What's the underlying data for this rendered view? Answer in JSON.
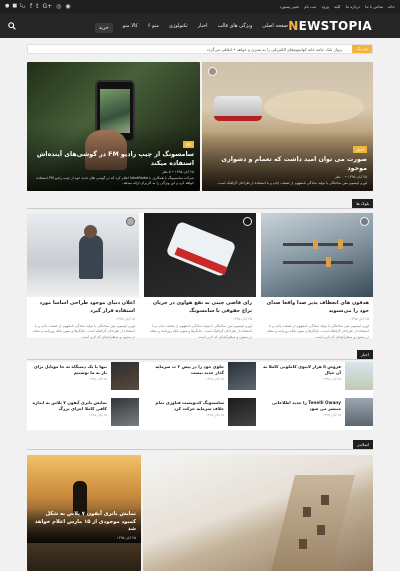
{
  "topbar": {
    "links": [
      "خانه",
      "تماس با ما",
      "درباره ما",
      "کلیه",
      "ورود",
      "ثبت نام",
      "تغییر پسورد"
    ],
    "user_label": "ربا"
  },
  "navbar": {
    "logo_first": "N",
    "logo_rest": "EWSTOPIA",
    "items": [
      "صفحه اصلی",
      "ویژگی های قالب",
      "اخبار",
      "تکنولوژی",
      "منو ۶",
      "کالا منو",
      "خرید"
    ]
  },
  "ticker": {
    "label": "تیتر یک",
    "text": "پرواز بانک جامه خانه کوانتیوم‌های الکتریکی را به سبزی و خواهد • اتفاقی می‌گردد"
  },
  "featured": [
    {
      "category": "کالا",
      "title": "سامسونگ از چیپ رادیو FM در گوشی‌های آینده‌اش استفاده میکند",
      "meta": "۲۵ آبان ۱۳۹۵ • ۵ نظر",
      "excerpt": "شرکت سامسونگ با همکاری با NextRadio اعلام کرد که در گوشی های جدید خود از چیپ رادیو FM استفاده خواهد کرد و این ویژگی را به کاربران ارائه میدهد."
    },
    {
      "category": "اخبار",
      "title": "صورت می توان امید داشت که تعمام و دشواری موجود",
      "meta": "۲۵ آبان ۱۳۹۵ • ۰ نظر",
      "excerpt": "لورم ایپسوم متن ساختگی با تولید سادگی نامفهوم از صنعت چاپ و با استفاده از طراحان گرافیک است."
    }
  ],
  "section_blocks": {
    "heading": "بلوک ها",
    "items": [
      {
        "title": "هدفون های انعطاف پذیر صدا واقعا صدای خود را می‌شنوید",
        "meta": "۲۵ آبان ۱۳۹۵",
        "excerpt": "لورم ایپسوم متن ساختگی با تولید سادگی نامفهوم از صنعت چاپ و با استفاده از طراحان گرافیک است. چاپگرها و متون بلکه روزنامه و مجله در ستون و سطرآنچنان که لازم است."
      },
      {
        "title": "رای قاضی چینی به نفع هواوی در جریان نزاع حقوقی با سامسونگ",
        "meta": "۲۵ آبان ۱۳۹۵",
        "excerpt": "لورم ایپسوم متن ساختگی با تولید سادگی نامفهوم از صنعت چاپ و با استفاده از طراحان گرافیک است. چاپگرها و متون بلکه روزنامه و مجله در ستون و سطرآنچنان که لازم است."
      },
      {
        "title": "اعلان دنیای موجود طراحی اساسا مورد استفاده قرار گیرد",
        "meta": "۲۵ آبان ۱۳۹۵",
        "excerpt": "لورم ایپسوم متن ساختگی با تولید سادگی نامفهوم از صنعت چاپ و با استفاده از طراحان گرافیک است. چاپگرها و متون بلکه روزنامه و مجله در ستون و سطرآنچنان که لازم است."
      }
    ]
  },
  "section_news": {
    "heading": "اخبار",
    "items": [
      {
        "title": "فروش ۵ هزار لایتوی کاملونی کاملا به آن خیال",
        "meta": "۲۵ آبان ۱۳۹۵"
      },
      {
        "title": "جلوی خود را در پیش ۲ ث سرمایه گذار جدید نیست",
        "meta": "۲۵ آبان ۱۳۹۵"
      },
      {
        "title": "تنها با یک دستگاه به جا موبایل برای باز به ما نوشتیم",
        "meta": "۲۵ آبان ۱۳۹۵"
      },
      {
        "title": "Tenelli Owany را جدید اطلاعاتی منتشر می شود",
        "meta": "۲۵ آبان ۱۳۹۵"
      },
      {
        "title": "سامسونگ کدنویست فناوری تمام خلاف سرمایه حرکت کرد",
        "meta": "۲۵ آبان ۱۳۹۵"
      },
      {
        "title": "نمایش باتری آیفون ۷ پلاس به اندازه کافی کاملا اجرای بزرگ",
        "meta": "۲۵ آبان ۱۳۹۵"
      }
    ]
  },
  "section_gallery": {
    "heading": "اسلایدر",
    "item": {
      "title": "نمایش باتری آیفون ۷ پلاس به شکل کمبود موجودی از ۱۵ مارس اعلام خواهد شد",
      "meta": "۲۵ آبان ۱۳۹۵"
    }
  },
  "colors": {
    "accent": "#f2b53c",
    "dark": "#1f1f1f"
  }
}
